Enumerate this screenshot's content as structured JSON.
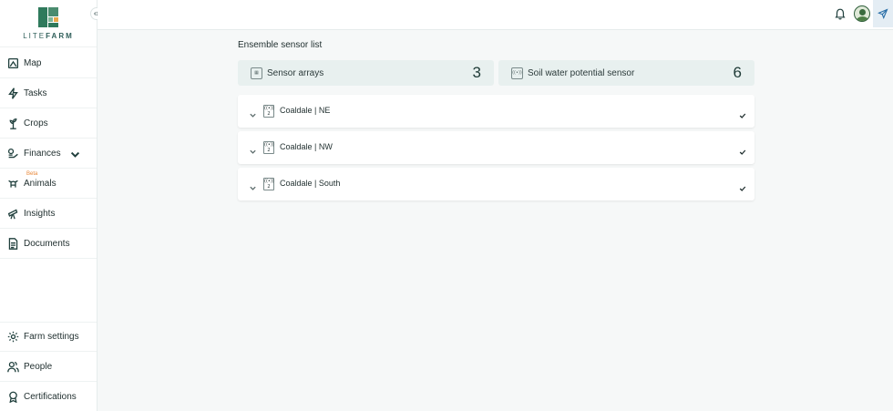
{
  "brand": {
    "logo_text_light": "LITE",
    "logo_text_bold": "FARM"
  },
  "sidebar": {
    "items": [
      {
        "label": "Map",
        "icon": "map-icon"
      },
      {
        "label": "Tasks",
        "icon": "lightning-icon"
      },
      {
        "label": "Crops",
        "icon": "plant-icon"
      },
      {
        "label": "Finances",
        "icon": "finances-icon",
        "has_dropdown": true
      },
      {
        "label": "Animals",
        "icon": "animal-icon",
        "badge": "Beta"
      },
      {
        "label": "Insights",
        "icon": "telescope-icon"
      },
      {
        "label": "Documents",
        "icon": "document-icon"
      }
    ],
    "bottom_items": [
      {
        "label": "Farm settings",
        "icon": "gear-icon"
      },
      {
        "label": "People",
        "icon": "people-icon"
      },
      {
        "label": "Certifications",
        "icon": "certificate-icon"
      }
    ]
  },
  "topbar": {
    "icons": [
      "bell-icon",
      "avatar",
      "send-icon"
    ]
  },
  "main": {
    "title": "Ensemble sensor list",
    "summary": [
      {
        "label": "Sensor arrays",
        "count": "3",
        "icon": "sensor-array-icon"
      },
      {
        "label": "Soil water potential sensor",
        "count": "6",
        "icon": "sensor-icon"
      }
    ],
    "rows": [
      {
        "label": "Coaldale | NE",
        "icon_count": "2"
      },
      {
        "label": "Coaldale | NW",
        "icon_count": "2"
      },
      {
        "label": "Coaldale | South",
        "icon_count": "2"
      }
    ]
  },
  "colors": {
    "accent": "#2f7a5c",
    "beta": "#e8883a",
    "send": "#2a6fa8",
    "summary_bg": "#e8f0ef"
  }
}
